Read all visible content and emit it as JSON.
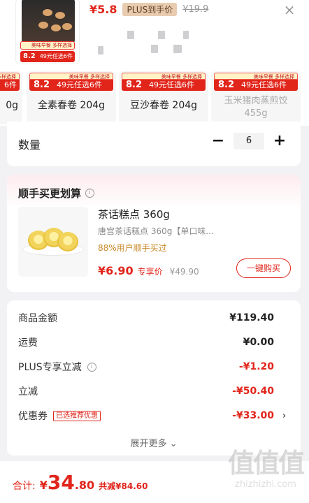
{
  "header": {
    "price_now": "¥5.8",
    "plus_tag": "PLUS到手价",
    "price_orig": "¥19.9",
    "close_icon": "×"
  },
  "thumbnail": {
    "strip_text": "美味早餐 多样选择",
    "bar_price": "8.2",
    "bar_text": "49元任选6件"
  },
  "variants": [
    {
      "name": "0g",
      "promo_top": "美味早餐 多样选择",
      "promo_price": "",
      "promo_text": "6件"
    },
    {
      "name": "全素春卷 204g",
      "promo_top": "美味早餐 多样选择",
      "promo_price": "8.2",
      "promo_text": "49元任选6件"
    },
    {
      "name": "豆沙春卷 204g",
      "promo_top": "美味早餐 多样选择",
      "promo_price": "8.2",
      "promo_text": "49元任选6件"
    },
    {
      "name": "玉米猪肉蒸煎饺 455g",
      "promo_top": "美味早餐 多样选择",
      "promo_price": "8.2",
      "promo_text": "49元任选6件",
      "disabled": true
    }
  ],
  "quantity": {
    "label": "数量",
    "value": "6",
    "minus": "−",
    "plus": "+"
  },
  "recommend": {
    "title": "顺手买更划算",
    "info_icon": "i",
    "product_name": "茶话糕点 360g",
    "product_desc": "唐宫茶话糕点 360g【单口味...",
    "rate_text": "88%用户顺手买过",
    "price": "¥6.90",
    "price_tag": "专享价",
    "price_orig": "¥49.90",
    "buy_label": "一键购买"
  },
  "price_detail": {
    "rows": [
      {
        "label": "商品金额",
        "value": "¥119.40"
      },
      {
        "label": "运费",
        "value": "¥0.00"
      },
      {
        "label": "PLUS专享立减",
        "value": "-¥1.20"
      },
      {
        "label": "立减",
        "value": "-¥50.40"
      },
      {
        "label": "优惠券",
        "value": "-¥33.00",
        "tag": "已选推荐优惠"
      }
    ],
    "expand_label": "展开更多 ⌄",
    "arrow": "›"
  },
  "bottom": {
    "total_label": "合计:",
    "currency": "¥",
    "total_int": "34",
    "total_dec": ".80",
    "saved": "共减¥84.60"
  },
  "watermark": {
    "logo": "值值值",
    "url": "zhizhizhi.com"
  },
  "colors": {
    "accent": "#e1251b",
    "plus": "#e8ccb0",
    "background": "#f2f2f4"
  }
}
